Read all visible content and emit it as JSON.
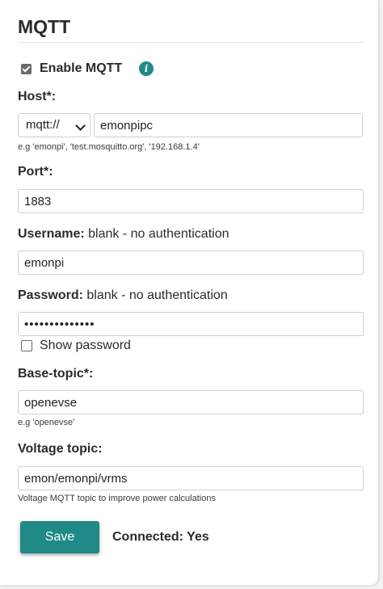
{
  "title": "MQTT",
  "enable": {
    "label": "Enable MQTT",
    "checked": true,
    "info_icon": "info-icon"
  },
  "host": {
    "label": "Host*:",
    "protocol": "mqtt://",
    "value": "emonpipc",
    "hint": "e.g 'emonpi', 'test.mosquitto.org', '192.168.1.4'"
  },
  "port": {
    "label": "Port*:",
    "value": "1883"
  },
  "username": {
    "label": "Username:",
    "note": "blank - no authentication",
    "value": "emonpi"
  },
  "password": {
    "label": "Password:",
    "note": "blank - no authentication",
    "value": "••••••••••••••",
    "show_label": "Show password",
    "show_checked": false
  },
  "base_topic": {
    "label": "Base-topic*:",
    "value": "openevse",
    "hint": "e.g 'openevse'"
  },
  "voltage_topic": {
    "label": "Voltage topic:",
    "value": "emon/emonpi/vrms",
    "hint": "Voltage MQTT topic to improve power calculations"
  },
  "save_label": "Save",
  "status": "Connected: Yes",
  "colors": {
    "accent": "#1f8a86",
    "text": "#2b2b2b"
  }
}
